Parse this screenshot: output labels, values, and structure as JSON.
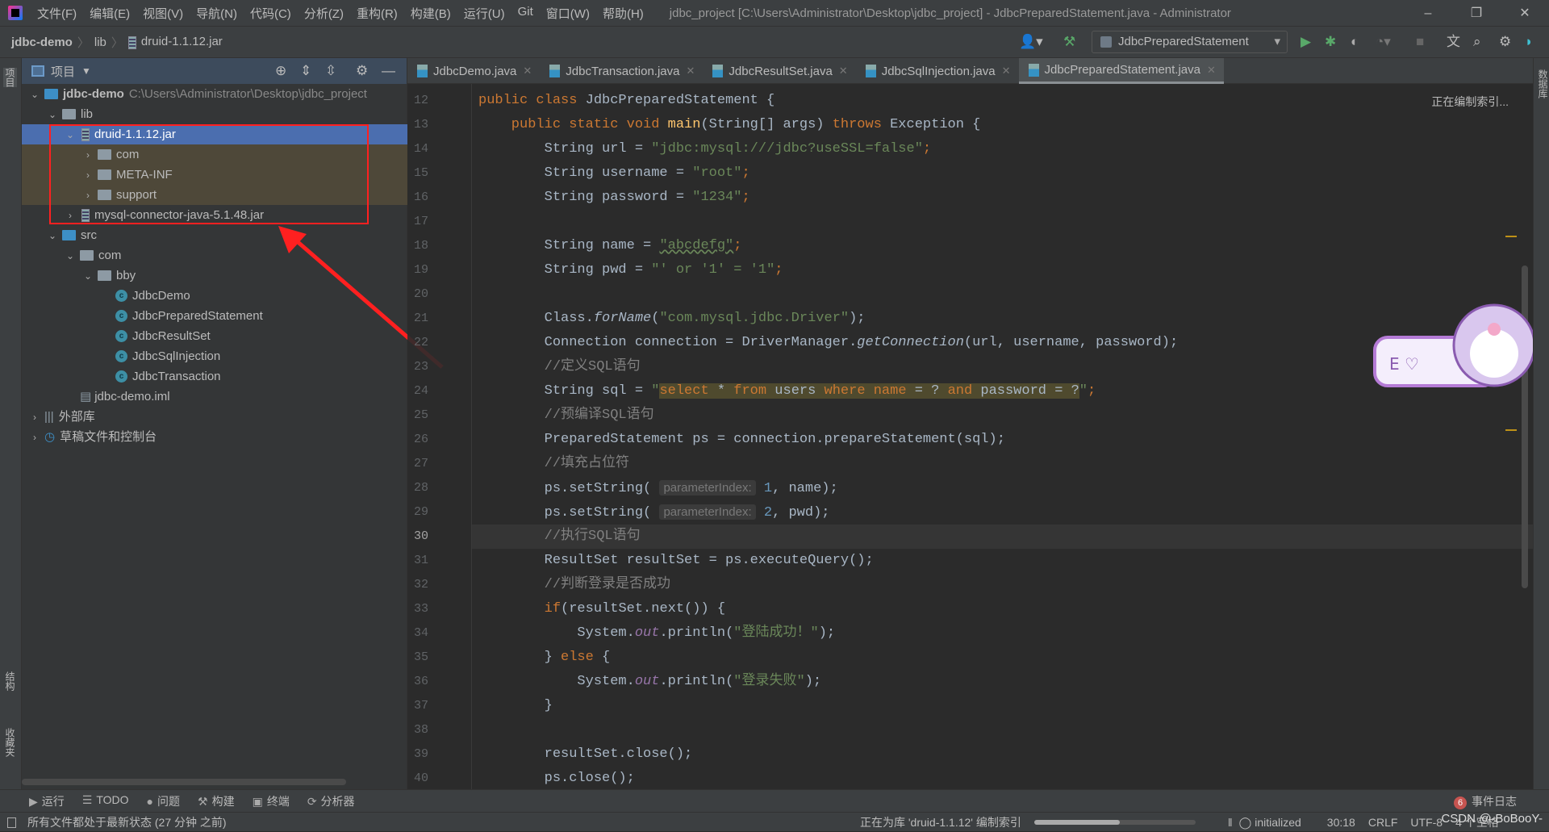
{
  "app": {
    "title": "jdbc_project [C:\\Users\\Administrator\\Desktop\\jdbc_project] - JdbcPreparedStatement.java - Administrator"
  },
  "menu": [
    "文件(F)",
    "编辑(E)",
    "视图(V)",
    "导航(N)",
    "代码(C)",
    "分析(Z)",
    "重构(R)",
    "构建(B)",
    "运行(U)",
    "Git",
    "窗口(W)",
    "帮助(H)"
  ],
  "window_buttons": {
    "minimize": "–",
    "restore": "❐",
    "close": "✕"
  },
  "breadcrumb": [
    "jdbc-demo",
    "lib",
    "druid-1.1.12.jar"
  ],
  "run_config": "JdbcPreparedStatement",
  "toolbar_icons": [
    "user-icon",
    "build-hammer-icon",
    "run-icon",
    "debug-icon",
    "coverage-icon",
    "profile-icon",
    "stop-icon",
    "translate-icon",
    "search-icon",
    "settings-icon",
    "plugin-icon"
  ],
  "project": {
    "header": "项目",
    "tree": [
      {
        "label": "jdbc-demo",
        "path": "C:\\Users\\Administrator\\Desktop\\jdbc_project",
        "depth": 0,
        "arrow": "v",
        "icon": "module",
        "bold": true
      },
      {
        "label": "lib",
        "depth": 1,
        "arrow": "v",
        "icon": "folder"
      },
      {
        "label": "druid-1.1.12.jar",
        "depth": 2,
        "arrow": "v",
        "icon": "jar",
        "selected": true
      },
      {
        "label": "com",
        "depth": 3,
        "arrow": ">",
        "icon": "folder",
        "lib": true
      },
      {
        "label": "META-INF",
        "depth": 3,
        "arrow": ">",
        "icon": "folder",
        "lib": true
      },
      {
        "label": "support",
        "depth": 3,
        "arrow": ">",
        "icon": "folder",
        "lib": true
      },
      {
        "label": "mysql-connector-java-5.1.48.jar",
        "depth": 2,
        "arrow": ">",
        "icon": "jar"
      },
      {
        "label": "src",
        "depth": 1,
        "arrow": "v",
        "icon": "src"
      },
      {
        "label": "com",
        "depth": 2,
        "arrow": "v",
        "icon": "package"
      },
      {
        "label": "bby",
        "depth": 3,
        "arrow": "v",
        "icon": "package"
      },
      {
        "label": "JdbcDemo",
        "depth": 4,
        "arrow": "",
        "icon": "class"
      },
      {
        "label": "JdbcPreparedStatement",
        "depth": 4,
        "arrow": "",
        "icon": "class"
      },
      {
        "label": "JdbcResultSet",
        "depth": 4,
        "arrow": "",
        "icon": "class"
      },
      {
        "label": "JdbcSqlInjection",
        "depth": 4,
        "arrow": "",
        "icon": "class"
      },
      {
        "label": "JdbcTransaction",
        "depth": 4,
        "arrow": "",
        "icon": "class"
      },
      {
        "label": "jdbc-demo.iml",
        "depth": 2,
        "arrow": "",
        "icon": "iml"
      },
      {
        "label": "外部库",
        "depth": 0,
        "arrow": ">",
        "icon": "library"
      },
      {
        "label": "草稿文件和控制台",
        "depth": 0,
        "arrow": ">",
        "icon": "scratch"
      }
    ]
  },
  "left_strip": {
    "top": "项目",
    "bottom1": "结构",
    "bottom2": "收藏夹"
  },
  "right_strip": "数据库",
  "tabs": [
    {
      "label": "JdbcDemo.java"
    },
    {
      "label": "JdbcTransaction.java"
    },
    {
      "label": "JdbcResultSet.java"
    },
    {
      "label": "JdbcSqlInjection.java"
    },
    {
      "label": "JdbcPreparedStatement.java",
      "active": true
    }
  ],
  "editor": {
    "indexing": "正在编制索引...",
    "current_line": 30,
    "lines": [
      {
        "n": 12,
        "t": [
          [
            "public class ",
            "kw"
          ],
          [
            "JdbcPreparedStatement {",
            ""
          ]
        ]
      },
      {
        "n": 13,
        "t": [
          [
            "    public static void ",
            "kw"
          ],
          [
            "main",
            "fn"
          ],
          [
            "(String[] args) ",
            ""
          ],
          [
            "throws ",
            "kw"
          ],
          [
            "Exception {",
            ""
          ]
        ]
      },
      {
        "n": 14,
        "t": [
          [
            "        String url = ",
            ""
          ],
          [
            "\"jdbc:mysql:///jdbc?useSSL=false\"",
            "str"
          ],
          [
            ";",
            "kw"
          ]
        ]
      },
      {
        "n": 15,
        "t": [
          [
            "        String username = ",
            ""
          ],
          [
            "\"root\"",
            "str"
          ],
          [
            ";",
            "kw"
          ]
        ]
      },
      {
        "n": 16,
        "t": [
          [
            "        String password = ",
            ""
          ],
          [
            "\"1234\"",
            "str"
          ],
          [
            ";",
            "kw"
          ]
        ]
      },
      {
        "n": 17,
        "t": []
      },
      {
        "n": 18,
        "t": [
          [
            "        String name = ",
            ""
          ],
          [
            "\"abcdefg\"",
            "str und"
          ],
          [
            ";",
            "kw"
          ]
        ]
      },
      {
        "n": 19,
        "t": [
          [
            "        String pwd = ",
            ""
          ],
          [
            "\"' or '1' = '1\"",
            "str"
          ],
          [
            ";",
            "kw"
          ]
        ]
      },
      {
        "n": 20,
        "t": []
      },
      {
        "n": 21,
        "t": [
          [
            "        Class.",
            ""
          ],
          [
            "forName",
            "it"
          ],
          [
            "(",
            ""
          ],
          [
            "\"com.mysql.jdbc.Driver\"",
            "str"
          ],
          [
            ");",
            ""
          ]
        ]
      },
      {
        "n": 22,
        "t": [
          [
            "        Connection connection = DriverManager.",
            ""
          ],
          [
            "getConnection",
            "it"
          ],
          [
            "(url, username, password);",
            ""
          ]
        ]
      },
      {
        "n": 23,
        "t": [
          [
            "        //定义SQL语句",
            "cm"
          ]
        ]
      },
      {
        "n": 24,
        "t": [
          [
            "        String sql = ",
            ""
          ],
          [
            "\"",
            "str"
          ],
          [
            "select",
            "sqlhl sqlkw"
          ],
          [
            " * ",
            "sqlhl"
          ],
          [
            "from",
            "sqlhl sqlkw"
          ],
          [
            " users ",
            "sqlhl"
          ],
          [
            "where name",
            "sqlhl sqlkw"
          ],
          [
            " = ? ",
            "sqlhl"
          ],
          [
            "and",
            "sqlhl sqlkw"
          ],
          [
            " password = ?",
            "sqlhl"
          ],
          [
            "\"",
            "str"
          ],
          [
            ";",
            "kw"
          ]
        ]
      },
      {
        "n": 25,
        "t": [
          [
            "        //预编译SQL语句",
            "cm"
          ]
        ]
      },
      {
        "n": 26,
        "t": [
          [
            "        PreparedStatement ps = connection.prepareStatement(sql);",
            ""
          ]
        ]
      },
      {
        "n": 27,
        "t": [
          [
            "        //填充占位符",
            "cm"
          ]
        ]
      },
      {
        "n": 28,
        "t": [
          [
            "        ps.setString( ",
            ""
          ],
          [
            "parameterIndex:",
            "hint"
          ],
          [
            " ",
            ""
          ],
          [
            "1",
            "num"
          ],
          [
            ", name);",
            ""
          ]
        ]
      },
      {
        "n": 29,
        "t": [
          [
            "        ps.setString( ",
            ""
          ],
          [
            "parameterIndex:",
            "hint"
          ],
          [
            " ",
            ""
          ],
          [
            "2",
            "num"
          ],
          [
            ", pwd);",
            ""
          ]
        ]
      },
      {
        "n": 30,
        "t": [
          [
            "        //执行SQL语句",
            "cm"
          ]
        ]
      },
      {
        "n": 31,
        "t": [
          [
            "        ResultSet resultSet = ps.executeQuery();",
            ""
          ]
        ]
      },
      {
        "n": 32,
        "t": [
          [
            "        //判断登录是否成功",
            "cm"
          ]
        ]
      },
      {
        "n": 33,
        "t": [
          [
            "        ",
            ""
          ],
          [
            "if",
            "kw"
          ],
          [
            "(resultSet.next()) {",
            ""
          ]
        ]
      },
      {
        "n": 34,
        "t": [
          [
            "            System.",
            ""
          ],
          [
            "out",
            "fld"
          ],
          [
            ".println(",
            ""
          ],
          [
            "\"登陆成功！\"",
            "str"
          ],
          [
            ");",
            ""
          ]
        ]
      },
      {
        "n": 35,
        "t": [
          [
            "        } ",
            ""
          ],
          [
            "else",
            "kw"
          ],
          [
            " {",
            ""
          ]
        ]
      },
      {
        "n": 36,
        "t": [
          [
            "            System.",
            ""
          ],
          [
            "out",
            "fld"
          ],
          [
            ".println(",
            ""
          ],
          [
            "\"登录失败\"",
            "str"
          ],
          [
            ");",
            ""
          ]
        ]
      },
      {
        "n": 37,
        "t": [
          [
            "        }",
            ""
          ]
        ]
      },
      {
        "n": 38,
        "t": []
      },
      {
        "n": 39,
        "t": [
          [
            "        resultSet.close();",
            ""
          ]
        ]
      },
      {
        "n": 40,
        "t": [
          [
            "        ps.close();",
            ""
          ]
        ]
      }
    ]
  },
  "tool_windows": [
    {
      "icon": "▶",
      "label": "运行"
    },
    {
      "icon": "☰",
      "label": "TODO"
    },
    {
      "icon": "●",
      "label": "问题"
    },
    {
      "icon": "⚒",
      "label": "构建"
    },
    {
      "icon": "▣",
      "label": "终端"
    },
    {
      "icon": "⟳",
      "label": "分析器"
    }
  ],
  "event_log": {
    "count": "6",
    "label": "事件日志"
  },
  "status": {
    "left": "所有文件都处于最新状态 (27 分钟 之前)",
    "indexing": "正在为库 'druid-1.1.12' 编制索引",
    "progress": 0.53,
    "vcs": "initialized",
    "position": "30:18",
    "line_sep": "CRLF",
    "encoding": "UTF-8",
    "indent": "4 个空格",
    "watermark": "CSDN @-BoBooY-"
  },
  "colors": {
    "accent": "#4b6eaf",
    "annotation": "#ff2020",
    "keyword": "#cc7832",
    "string": "#6a8759",
    "comment": "#808080"
  }
}
